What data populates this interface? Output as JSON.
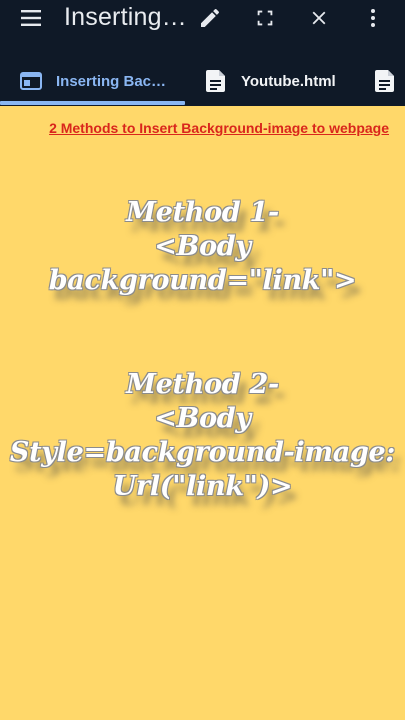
{
  "appbar": {
    "title": "Inserting…",
    "icons": [
      "menu-icon",
      "pencil-icon",
      "fullscreen-icon",
      "close-icon",
      "more-vert-icon"
    ]
  },
  "tabs": [
    {
      "label": "Inserting Bac…",
      "icon": "web-page-icon",
      "active": true
    },
    {
      "label": "Youtube.html",
      "icon": "document-icon",
      "active": false
    },
    {
      "label": "",
      "icon": "document-icon",
      "active": false
    }
  ],
  "colors": {
    "appbar_bg": "#0f1927",
    "active_tab": "#8ab6f2",
    "page_bg": "#ffd86a",
    "link": "#d9261c"
  },
  "page": {
    "link_text": "2 Methods to Insert Background-image to webpage",
    "method1": {
      "line1": "Method 1-",
      "line2": "<Body background=\"link\">"
    },
    "method2": {
      "line1": "Method 2-",
      "line2": "<Body",
      "line3": "Style=background-image:",
      "line4": "Url(\"link\")>"
    }
  }
}
